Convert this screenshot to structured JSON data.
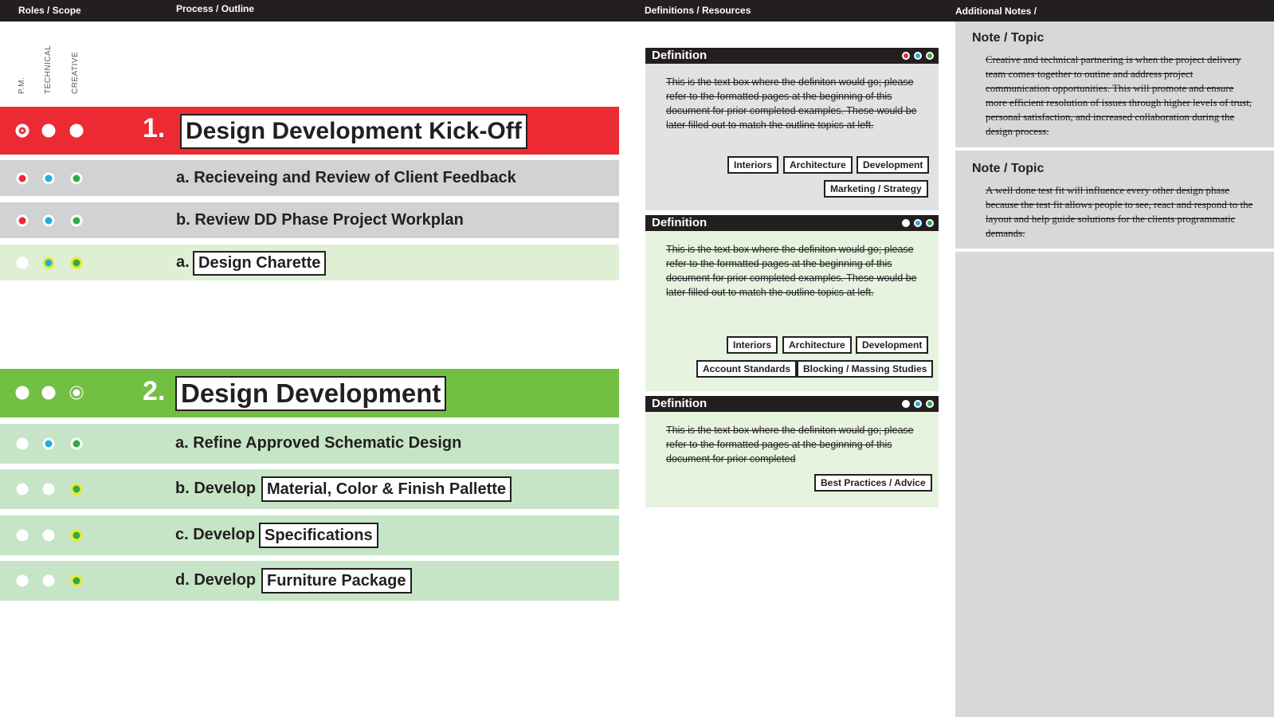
{
  "header": {
    "roles_label": "Roles / Scope",
    "process_label": "Process / Outline",
    "definitions_label": "Definitions / Resources",
    "notes_label": "Additional Notes /"
  },
  "roles": [
    "P.M.",
    "TECHNICAL",
    "CREATIVE"
  ],
  "colors": {
    "pm": "#ec2a33",
    "technical": "#27aae1",
    "creative": "#39a54a",
    "highlight_yellow": "#e4ee2b",
    "phase1_bg": "#ec2a33",
    "phase2_bg": "#72bf44",
    "gray_row": "#d1d2d4",
    "light_green_row": "#dfefd4",
    "green_row": "#c5e5c6",
    "card_gray": "#e2e2e2",
    "card_green": "#e5f3df",
    "notes_bg": "#d8d8d8"
  },
  "phases": [
    {
      "number": "1.",
      "title": "Design Development Kick-Off",
      "items": [
        {
          "prefix": "a. Recieveing and Review of Client Feedback",
          "boxed": ""
        },
        {
          "prefix": "b. Review DD Phase Project Workplan",
          "boxed": ""
        },
        {
          "prefix": "a.",
          "boxed": "Design Charette"
        }
      ]
    },
    {
      "number": "2.",
      "title": "Design Development",
      "items": [
        {
          "prefix": "a. Refine Approved Schematic Design",
          "boxed": ""
        },
        {
          "prefix": "b. Develop",
          "boxed": "Material, Color & Finish Pallette"
        },
        {
          "prefix": "c. Develop",
          "boxed": "Specifications"
        },
        {
          "prefix": "d. Develop",
          "boxed": "Furniture Package"
        }
      ]
    }
  ],
  "definitions": [
    {
      "title": "Definition",
      "text": "This is the text box where the definiton would go; please refer to the formatted pages at the beginning of this document for prior completed examples. These would be later filled out to match the outline topics at left.",
      "tags": [
        "Interiors",
        "Architecture",
        "Development",
        "Marketing / Strategy"
      ]
    },
    {
      "title": "Definition",
      "text": "This is the text box where the definiton would go; please refer to the formatted pages at the beginning of this document for prior completed examples. These would be later filled out to match the outline topics at left.",
      "tags": [
        "Interiors",
        "Architecture",
        "Development",
        "Account Standards",
        "Blocking / Massing Studies"
      ]
    },
    {
      "title": "Definition",
      "text": "This is the text box where the definiton would go; please refer to the formatted pages at the beginning of this document for prior completed",
      "tags": [
        "Best Practices / Advice"
      ]
    }
  ],
  "notes": [
    {
      "title": "Note / Topic",
      "text": "Creative and technical partnering is when the project delivery team comes together to outine and address project communication opportunities. This will promote and ensure more efficient resolution of issues through higher levels of trust, personal satisfaction, and increased collaboration during the design process."
    },
    {
      "title": "Note / Topic",
      "text": "A well done test fit will influence every other  design phase because the test fit allows people to see, react and respond to the layout and help guide solutions for the clients programmatic demands."
    }
  ]
}
